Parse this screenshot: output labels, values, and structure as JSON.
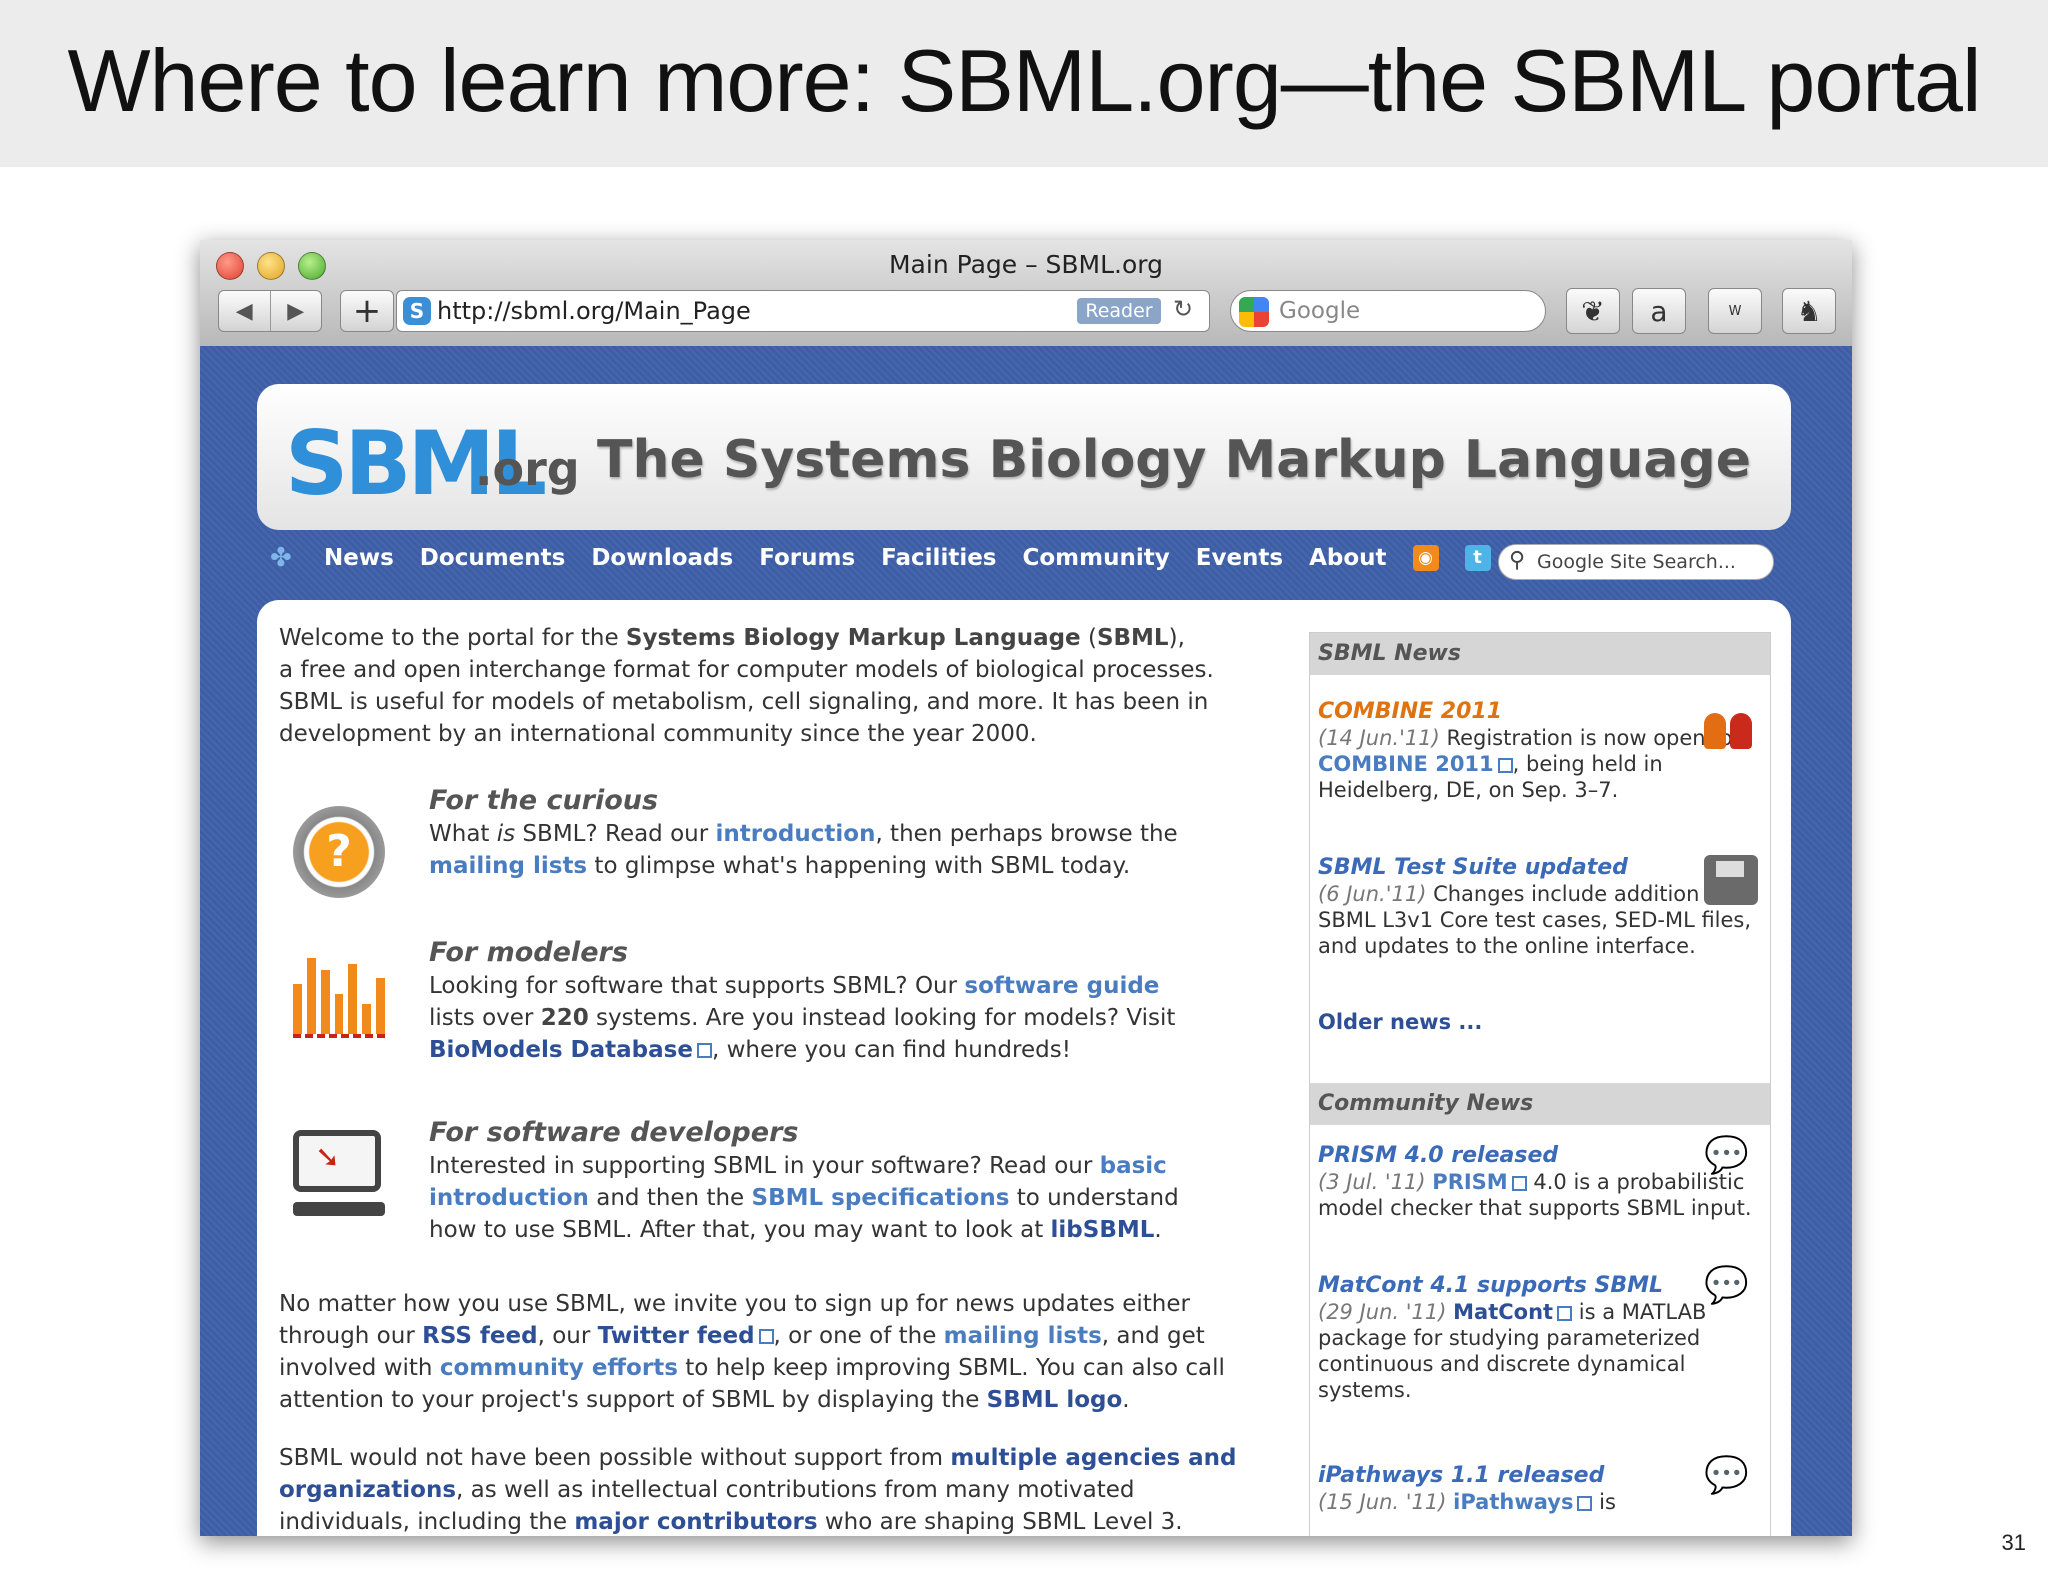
{
  "slide": {
    "title": "Where to learn more: SBML.org—the SBML portal",
    "page_number": "31"
  },
  "browser": {
    "window_title": "Main Page – SBML.org",
    "url": "http://sbml.org/Main_Page",
    "reader_label": "Reader",
    "search_placeholder": "Google",
    "toolbar_icons": [
      "leaf-icon",
      "amazon-icon",
      "word-icon",
      "evernote-icon"
    ]
  },
  "site": {
    "logo_text": "SBML",
    "logo_suffix": ".org",
    "tagline": "The Systems Biology Markup Language",
    "nav": [
      "News",
      "Documents",
      "Downloads",
      "Forums",
      "Facilities",
      "Community",
      "Events",
      "About"
    ],
    "search_placeholder": "Google Site Search...",
    "intro": {
      "p1": "Welcome to the portal for the ",
      "p1_bold": "Systems Biology Markup Language",
      "p1_b": " (",
      "p1_abbr": "SBML",
      "p1_c": "),",
      "p2": "a free and open interchange format for computer models of biological processes.",
      "p3": "SBML is useful for models of metabolism, cell signaling, and more. It has been in",
      "p4": "development by an international community since the year 2000."
    },
    "curious": {
      "heading": "For the curious",
      "a": "What ",
      "is": "is",
      "b": " SBML? Read our ",
      "link1": "introduction",
      "c": ", then perhaps browse the",
      "link2": "mailing lists",
      "d": " to glimpse what's happening with SBML today."
    },
    "modelers": {
      "heading": "For modelers",
      "a": "Looking for software that supports SBML? Our ",
      "link1": "software guide",
      "b": "lists over ",
      "count": "220",
      "c": " systems. Are you instead looking for models? Visit",
      "link2": "BioModels Database",
      "d": ", where you can find hundreds!"
    },
    "developers": {
      "heading": "For software developers",
      "a": "Interested in supporting SBML in your software? Read our ",
      "link1a": "basic",
      "link1b": "introduction",
      "b": " and then the ",
      "link2": "SBML specifications",
      "c": " to understand",
      "d": "how to use SBML. After that, you may want to look at ",
      "link3": "libSBML",
      "e": "."
    },
    "signup": {
      "a": "No matter how you use SBML, we invite you to sign up for news updates either",
      "b": "through our ",
      "rss": "RSS feed",
      "c": ", our ",
      "twitter": "Twitter feed",
      "d": ", or one of the ",
      "mailing": "mailing lists",
      "e": ", and get",
      "f": "involved with ",
      "community": "community efforts",
      "g": " to help keep improving SBML. You can also call",
      "h": "attention to your project's support of SBML by displaying the ",
      "logo": "SBML logo",
      "i": "."
    },
    "support": {
      "a": "SBML would not have been possible without support from ",
      "link1": "multiple agencies and",
      "link1b": "organizations",
      "b": ", as well as intellectual contributions from many motivated",
      "c": "individuals, including the ",
      "link2": "major contributors",
      "d": " who are shaping SBML Level 3."
    },
    "sidebar": {
      "news_heading": "SBML News",
      "news": [
        {
          "title": "COMBINE 2011",
          "date": "(14 Jun.'11)",
          "text_a": " Registration is now open for ",
          "link": "COMBINE 2011",
          "text_b": ", being held in Heidelberg, DE, on Sep. 3–7."
        },
        {
          "title": "SBML Test Suite updated",
          "date": "(6 Jun.'11)",
          "text": " Changes include addition of SBML L3v1 Core test cases, SED-ML files, and updates to the online interface."
        }
      ],
      "older_news": "Older news ...",
      "community_heading": "Community News",
      "community": [
        {
          "title": "PRISM 4.0 released",
          "date": "(3 Jul. '11)",
          "link": "PRISM",
          "text": " 4.0 is a probabilistic model checker that supports SBML input."
        },
        {
          "title": "MatCont 4.1 supports SBML",
          "date": "(29 Jun. '11)",
          "link": "MatCont",
          "text": " is a MATLAB package for studying parameterized continuous and discrete dynamical systems."
        },
        {
          "title": "iPathways 1.1 released",
          "date": "(15 Jun. '11)",
          "link": "iPathways",
          "text": " is"
        }
      ]
    }
  }
}
